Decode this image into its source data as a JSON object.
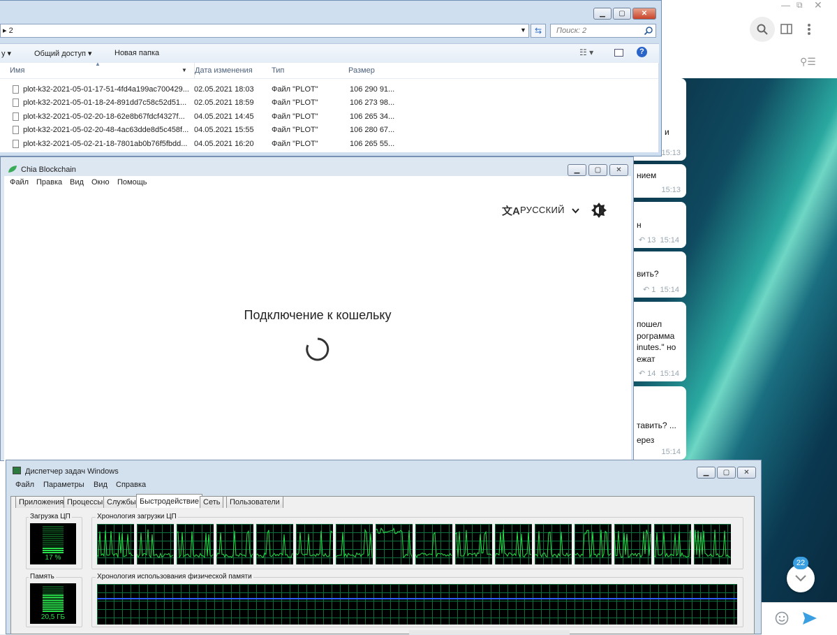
{
  "telegram": {
    "unread_badge": "22",
    "messages": [
      {
        "text": "и",
        "time": "15:13"
      },
      {
        "text": "нием",
        "time": "15:13"
      },
      {
        "text": "н",
        "replies": "13",
        "time": "15:14"
      },
      {
        "text": "вить?",
        "replies": "1",
        "time": "15:14"
      },
      {
        "text": "пошел\nрограмма\ninutes.\" но\nежат",
        "replies": "14",
        "time": "15:14"
      },
      {
        "text": "тавить? ...\nерез",
        "time": "15:14"
      }
    ]
  },
  "explorer": {
    "address_fragment": "2",
    "search_placeholder": "Поиск: 2",
    "toolbar": {
      "organize_fragment": "у ▾",
      "share": "Общий доступ",
      "new_folder": "Новая папка"
    },
    "columns": [
      "Имя",
      "Дата изменения",
      "Тип",
      "Размер"
    ],
    "files": [
      {
        "name": "plot-k32-2021-05-01-17-51-4fd4a199ac700429...",
        "date": "02.05.2021 18:03",
        "type": "Файл \"PLOT\"",
        "size": "106 290 91..."
      },
      {
        "name": "plot-k32-2021-05-01-18-24-891dd7c58c52d51...",
        "date": "02.05.2021 18:59",
        "type": "Файл \"PLOT\"",
        "size": "106 273 98..."
      },
      {
        "name": "plot-k32-2021-05-02-20-18-62e8b67fdcf4327f...",
        "date": "04.05.2021 14:45",
        "type": "Файл \"PLOT\"",
        "size": "106 265 34..."
      },
      {
        "name": "plot-k32-2021-05-02-20-48-4ac63dde8d5c458f...",
        "date": "04.05.2021 15:55",
        "type": "Файл \"PLOT\"",
        "size": "106 280 67..."
      },
      {
        "name": "plot-k32-2021-05-02-21-18-7801ab0b76f5fbdd...",
        "date": "04.05.2021 16:20",
        "type": "Файл \"PLOT\"",
        "size": "106 265 55..."
      }
    ]
  },
  "chia": {
    "title": "Chia Blockchain",
    "menu": [
      "Файл",
      "Правка",
      "Вид",
      "Окно",
      "Помощь"
    ],
    "language": "РУССКИЙ",
    "status": "Подключение к кошельку"
  },
  "taskmgr": {
    "title": "Диспетчер задач Windows",
    "menu": [
      "Файл",
      "Параметры",
      "Вид",
      "Справка"
    ],
    "tabs": [
      "Приложения",
      "Процессы",
      "Службы",
      "Быстродействие",
      "Сеть",
      "Пользователи"
    ],
    "active_tab": "Быстродействие",
    "cpu_label": "Загрузка ЦП",
    "cpu_value": "17 %",
    "cpu_history_label": "Хронология загрузки ЦП",
    "memory_label": "Память",
    "memory_value": "20,5 ГБ",
    "memory_history_label": "Хронология использования физической памяти"
  },
  "colors": {
    "accent_green": "#27e04a",
    "memory_line": "#2b5cff",
    "telegram_accent": "#3a9fe0"
  }
}
